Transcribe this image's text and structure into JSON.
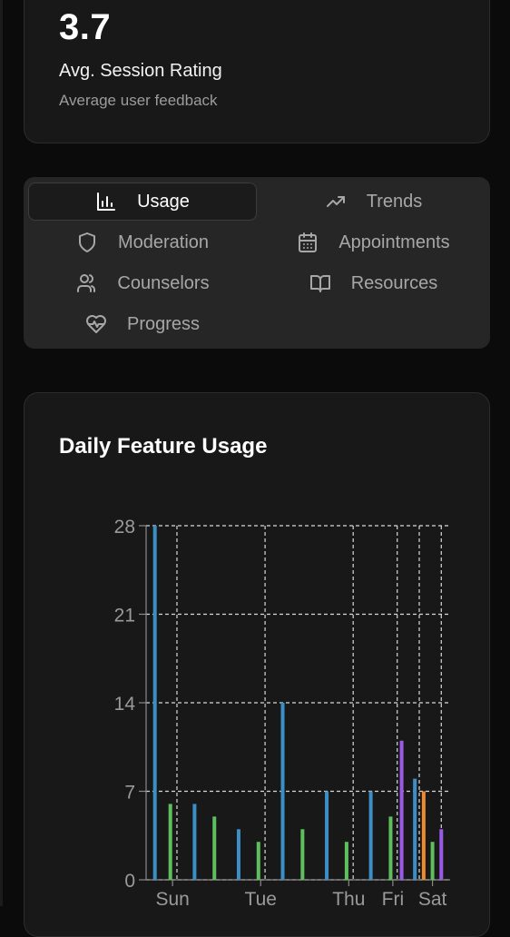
{
  "stat": {
    "value": "3.7",
    "label": "Avg. Session Rating",
    "sublabel": "Average user feedback"
  },
  "tabs": [
    {
      "label": "Usage",
      "icon": "bar-chart-icon",
      "active": true
    },
    {
      "label": "Trends",
      "icon": "trending-up-icon",
      "active": false
    },
    {
      "label": "Moderation",
      "icon": "shield-icon",
      "active": false
    },
    {
      "label": "Appointments",
      "icon": "calendar-icon",
      "active": false
    },
    {
      "label": "Counselors",
      "icon": "users-icon",
      "active": false
    },
    {
      "label": "Resources",
      "icon": "book-open-icon",
      "active": false
    },
    {
      "label": "Progress",
      "icon": "heart-pulse-icon",
      "active": false
    }
  ],
  "chart": {
    "title": "Daily Feature Usage"
  },
  "chart_data": {
    "type": "bar",
    "ylim": [
      0,
      28
    ],
    "yticks": [
      "0",
      "7",
      "14",
      "21",
      "28"
    ],
    "xticks": [
      "Sun",
      "Tue",
      "Thu",
      "Fri",
      "Sat"
    ],
    "grid": true,
    "colors": {
      "blue": "#3b8fc4",
      "green": "#5fbf5f",
      "purple": "#9b59e8",
      "orange": "#f08a2e"
    },
    "bars": [
      {
        "x": 0.0,
        "value": 28,
        "color": "blue"
      },
      {
        "x": 0.35,
        "value": 6,
        "color": "green"
      },
      {
        "x": 0.9,
        "value": 6,
        "color": "blue"
      },
      {
        "x": 1.35,
        "value": 5,
        "color": "green"
      },
      {
        "x": 1.9,
        "value": 4,
        "color": "blue"
      },
      {
        "x": 2.35,
        "value": 3,
        "color": "green"
      },
      {
        "x": 2.9,
        "value": 14,
        "color": "blue"
      },
      {
        "x": 3.35,
        "value": 4,
        "color": "green"
      },
      {
        "x": 3.9,
        "value": 7,
        "color": "blue"
      },
      {
        "x": 4.35,
        "value": 3,
        "color": "green"
      },
      {
        "x": 4.9,
        "value": 7,
        "color": "blue"
      },
      {
        "x": 5.35,
        "value": 5,
        "color": "green"
      },
      {
        "x": 5.6,
        "value": 11,
        "color": "purple"
      },
      {
        "x": 5.9,
        "value": 8,
        "color": "blue"
      },
      {
        "x": 6.1,
        "value": 7,
        "color": "orange"
      },
      {
        "x": 6.3,
        "value": 3,
        "color": "green"
      },
      {
        "x": 6.5,
        "value": 4,
        "color": "purple"
      }
    ]
  }
}
